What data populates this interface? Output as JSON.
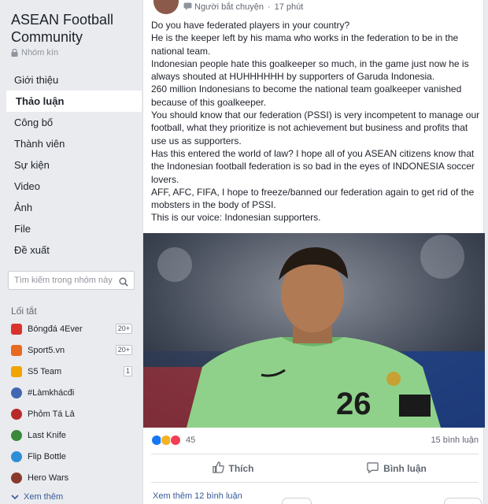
{
  "group": {
    "title": "ASEAN Football Community",
    "privacy": "Nhóm kín"
  },
  "nav": [
    {
      "label": "Giới thiệu",
      "active": false
    },
    {
      "label": "Thảo luận",
      "active": true
    },
    {
      "label": "Công bố",
      "active": false
    },
    {
      "label": "Thành viên",
      "active": false
    },
    {
      "label": "Sự kiện",
      "active": false
    },
    {
      "label": "Video",
      "active": false
    },
    {
      "label": "Ảnh",
      "active": false
    },
    {
      "label": "File",
      "active": false
    },
    {
      "label": "Đề xuất",
      "active": false
    }
  ],
  "search": {
    "placeholder": "Tìm kiếm trong nhóm này"
  },
  "shortcuts_title": "Lối tắt",
  "shortcuts": [
    {
      "label": "Bóngđá 4Ever",
      "badge": "20+",
      "color": "#d9332e"
    },
    {
      "label": "Sport5.vn",
      "badge": "20+",
      "color": "#e86a1f"
    },
    {
      "label": "S5 Team",
      "badge": "1",
      "color": "#f0a400"
    },
    {
      "label": "#Làmkhácđi",
      "badge": "",
      "color": "#4267b2"
    },
    {
      "label": "Phỏm Tá Lả",
      "badge": "",
      "color": "#b82a2a"
    },
    {
      "label": "Last Knife",
      "badge": "",
      "color": "#3b8a3a"
    },
    {
      "label": "Flip Bottle",
      "badge": "",
      "color": "#2e8fd8"
    },
    {
      "label": "Hero Wars",
      "badge": "",
      "color": "#8a3a2a"
    }
  ],
  "see_more": "Xem thêm",
  "post": {
    "author_label": "Người bắt chuyện",
    "time": "17 phút",
    "text": "Do you have federated players in your country?\nHe is the keeper left by his mama who works in the federation to be in the national team.\nIndonesian people hate this goalkeeper so much, in the game just now he is always shouted at HUHHHHHH by supporters of Garuda Indonesia.\n260 million Indonesians to become the national team goalkeeper vanished because of this goalkeeper.\nYou should know that our federation (PSSI) is very incompetent to manage our football, what they prioritize is not achievement but business and profits that use us as supporters.\nHas this entered the world of law? I hope all of you ASEAN citizens know that the Indonesian football federation is so bad in the eyes of INDONESIA soccer lovers.\nAFF, AFC, FIFA, I hope to freeze/banned our federation again to get rid of the mobsters in the body of PSSI.\nThis is our voice: Indonesian supporters.",
    "photo_jersey_number": "26",
    "reactions_count": "45",
    "comments_count": "15 bình luận",
    "like_label": "Thích",
    "comment_label": "Bình luận",
    "view_more_comments": "Xem thêm 12 bình luận"
  },
  "colors": {
    "accent": "#385898",
    "like_blue": "#1877f2",
    "sad_yellow": "#f7b125",
    "love_red": "#f33e58",
    "jersey_green": "#8fd18a"
  }
}
